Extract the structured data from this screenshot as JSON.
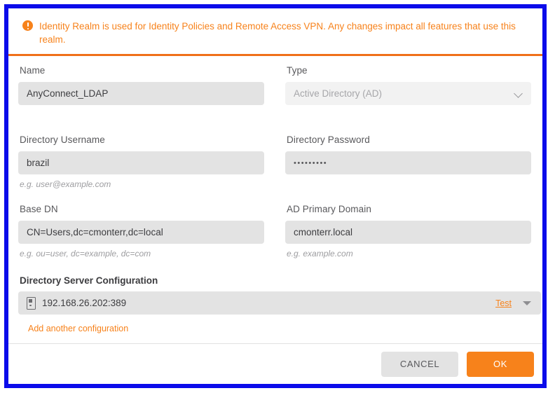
{
  "banner": {
    "icon": "warning-circle-icon",
    "text": "Identity Realm is used for Identity Policies and Remote Access VPN. Any changes impact all features that use this realm.",
    "color": "#f7821b"
  },
  "form": {
    "left": [
      {
        "label": "Name",
        "value": "AnyConnect_LDAP",
        "hint": ""
      },
      {
        "label": "Directory Username",
        "value": "brazil",
        "hint": "e.g. user@example.com"
      },
      {
        "label": "Base DN",
        "value": "CN=Users,dc=cmonterr,dc=local",
        "hint": "e.g. ou=user, dc=example, dc=com"
      }
    ],
    "right": [
      {
        "label": "Type",
        "value": "Active Directory (AD)",
        "hint": "",
        "control": "select",
        "icon": "chevron-down-icon"
      },
      {
        "label": "Directory Password",
        "value": "•••••••••",
        "hint": ""
      },
      {
        "label": "AD Primary Domain",
        "value": "cmonterr.local",
        "hint": "e.g. example.com"
      }
    ]
  },
  "directory_server": {
    "section_label": "Directory Server Configuration",
    "server_icon": "server-tower-icon",
    "address": "192.168.26.202:389",
    "test_label": "Test",
    "caret_icon": "caret-down-icon",
    "add_link": "Add another configuration"
  },
  "footer": {
    "cancel_label": "CANCEL",
    "ok_label": "OK"
  },
  "colors": {
    "accent": "#f7821b",
    "selection_frame": "#0b0bea",
    "input_bg": "#e3e3e3",
    "disabled_bg": "#f2f2f2"
  }
}
